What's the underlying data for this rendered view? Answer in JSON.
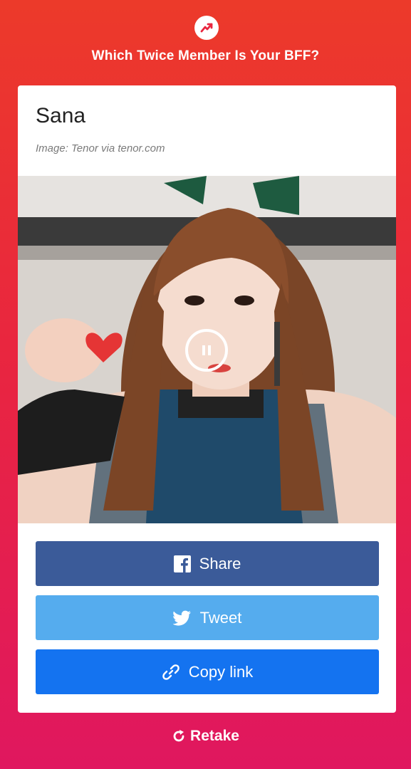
{
  "header": {
    "title": "Which Twice Member Is Your BFF?",
    "badge_icon": "trending-icon"
  },
  "result": {
    "name": "Sana",
    "credit": "Image: Tenor via tenor.com",
    "media_control_icon": "pause-icon"
  },
  "share": {
    "facebook_label": "Share",
    "twitter_label": "Tweet",
    "copy_label": "Copy link"
  },
  "footer": {
    "retake_label": "Retake"
  },
  "colors": {
    "facebook": "#3b5b99",
    "twitter": "#55acee",
    "copy": "#1473f0",
    "accent_red": "#e9263f"
  }
}
